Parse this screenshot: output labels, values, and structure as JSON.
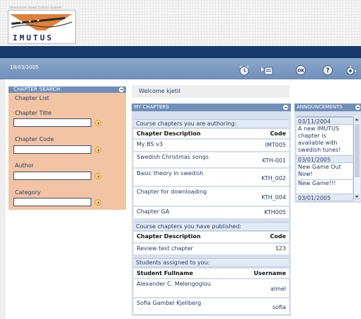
{
  "header": {
    "tagline": "interactive music tuition system",
    "logo_text": "IMUTUS"
  },
  "toolbar": {
    "date": "18/03/2005",
    "icons": [
      "clock-icon",
      "options-icon",
      "ok-icon",
      "help-icon",
      "settings-icon"
    ]
  },
  "search": {
    "title": "CHAPTER SEARCH",
    "list_link": "Chapter List",
    "fields": [
      {
        "label": "Chapter Title",
        "value": ""
      },
      {
        "label": "Chapter Code",
        "value": ""
      },
      {
        "label": "Author",
        "value": ""
      },
      {
        "label": "Category",
        "value": ""
      }
    ]
  },
  "welcome": "Welcome kjetil",
  "chapters": {
    "title": "MY CHAPTERS",
    "authoring": {
      "section": "Course chapters you are authoring:",
      "col1": "Chapter Description",
      "col2": "Code",
      "rows": [
        {
          "desc": "My BS v3",
          "code": "IMT005"
        },
        {
          "desc": "Swedish Christmas songs",
          "code": "KTH-001"
        },
        {
          "desc": "Basic theory in swedish",
          "code": "KTH_002"
        },
        {
          "desc": "Chapter for downloading",
          "code": "KTH_004"
        },
        {
          "desc": "Chapter GA",
          "code": "KTH005"
        }
      ]
    },
    "published": {
      "section": "Course chapters you have published:",
      "col1": "Chapter Description",
      "col2": "Code",
      "rows": [
        {
          "desc": "Review test chapter",
          "code": "123"
        }
      ]
    },
    "students": {
      "section": "Students assigned to you:",
      "col1": "Student Fullname",
      "col2": "Username",
      "rows": [
        {
          "name": "Alexander C. Melengoglou",
          "user": "almel"
        },
        {
          "name": "Sofia Gambel Kjellberg",
          "user": "sofia"
        }
      ]
    }
  },
  "announcements": {
    "title": "ANNOUNCEMENTS",
    "items": [
      {
        "date": "03/11/2004",
        "text": "A new IMUTUS chapter is available with swedish tunes!"
      },
      {
        "date": "03/01/2005",
        "text": "New Game Out Now!"
      },
      {
        "date": "",
        "text": "New Game!!!"
      },
      {
        "date": "03/01/2005",
        "text": ""
      }
    ]
  }
}
